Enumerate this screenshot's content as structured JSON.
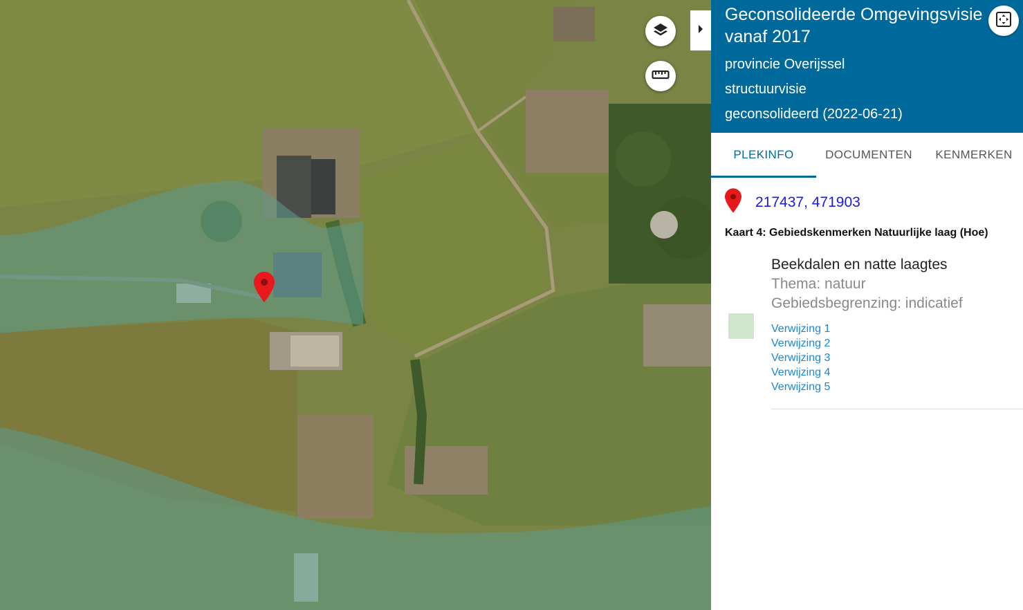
{
  "panel": {
    "title": "Geconsolideerde Omgevingsvisie vanaf 2017",
    "province": "provincie Overijssel",
    "type": "structuurvisie",
    "status": "geconsolideerd (2022-06-21)"
  },
  "tabs": [
    {
      "label": "PLEKINFO",
      "active": true
    },
    {
      "label": "DOCUMENTEN",
      "active": false
    },
    {
      "label": "KENMERKEN",
      "active": false
    }
  ],
  "location": {
    "coords": "217437, 471903"
  },
  "map_name": "Kaart 4: Gebiedskenmerken Natuurlijke laag (Hoe)",
  "feature": {
    "name": "Beekdalen en natte laagtes",
    "theme": "Thema: natuur",
    "boundary": "Gebiedsbegrenzing: indicatief",
    "swatch_color": "#cfe6cd",
    "references": [
      "Verwijzing 1",
      "Verwijzing 2",
      "Verwijzing 3",
      "Verwijzing 4",
      "Verwijzing 5"
    ]
  },
  "colors": {
    "header": "#00699b",
    "link": "#1a86d9",
    "coords": "#1a1ae6",
    "pin": "#e8191d"
  },
  "icons": {
    "layers": "layers-icon",
    "measure": "ruler-icon",
    "collapse": "chevron-right-icon",
    "fullscreen": "fullscreen-icon",
    "location": "map-pin-icon"
  }
}
